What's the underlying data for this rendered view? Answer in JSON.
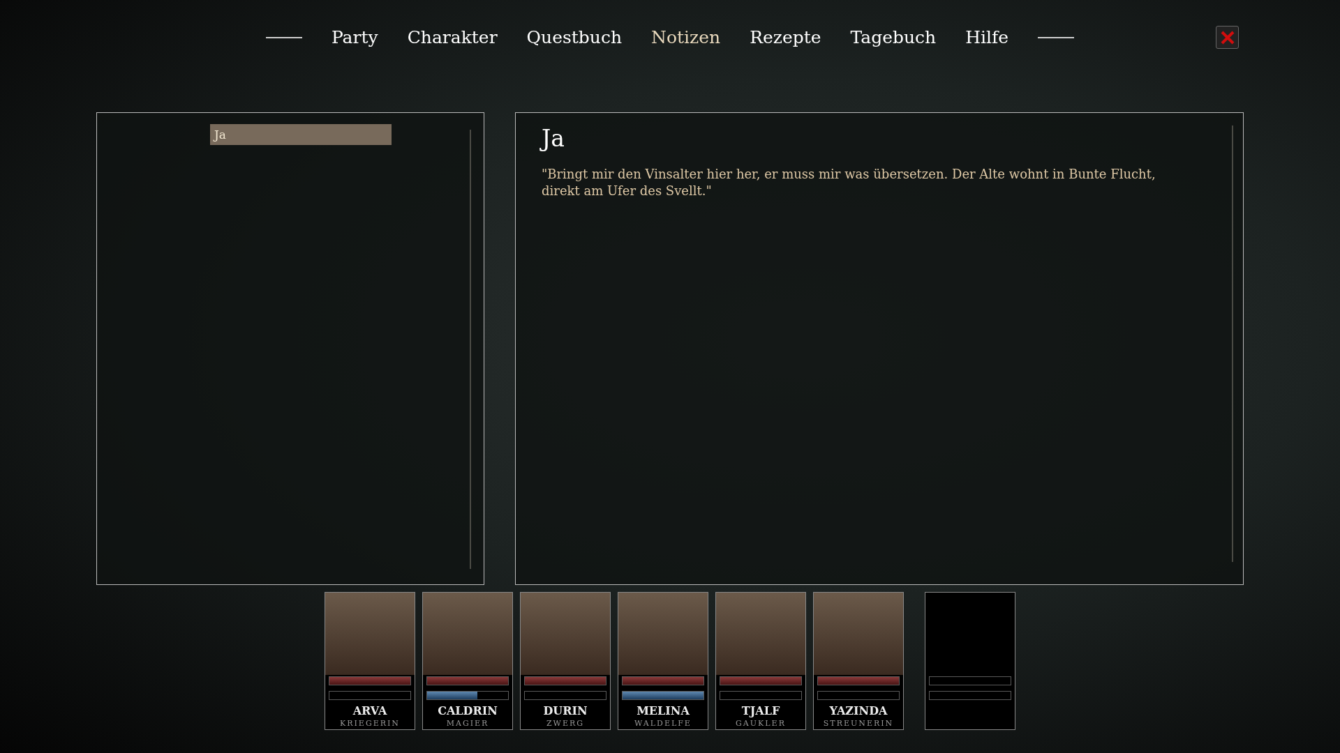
{
  "tabs": [
    {
      "label": "Party",
      "selected": false
    },
    {
      "label": "Charakter",
      "selected": false
    },
    {
      "label": "Questbuch",
      "selected": false
    },
    {
      "label": "Notizen",
      "selected": true
    },
    {
      "label": "Rezepte",
      "selected": false
    },
    {
      "label": "Tagebuch",
      "selected": false
    },
    {
      "label": "Hilfe",
      "selected": false
    }
  ],
  "notes_list": [
    {
      "title": "Ja",
      "selected": true
    }
  ],
  "note": {
    "title": "Ja",
    "body": "\"Bringt mir den Vinsalter hier her, er muss mir was übersetzen. Der Alte wohnt in Bunte Flucht, direkt am Ufer des Svellt.\""
  },
  "party": [
    {
      "kind": "hero",
      "name": "ARVA",
      "class": "KRIEGERIN",
      "health": {
        "level": 1
      },
      "mana": {
        "level": 0
      }
    },
    {
      "kind": "hero",
      "name": "CALDRIN",
      "class": "MAGIER",
      "health": {
        "level": 1
      },
      "mana": {
        "level": 0.62
      }
    },
    {
      "kind": "hero",
      "name": "DURIN",
      "class": "ZWERG",
      "health": {
        "level": 1
      },
      "mana": {
        "level": 0
      }
    },
    {
      "kind": "hero",
      "name": "MELINA",
      "class": "WALDELFE",
      "health": {
        "level": 1
      },
      "mana": {
        "level": 1
      }
    },
    {
      "kind": "hero",
      "name": "TJALF",
      "class": "GAUKLER",
      "health": {
        "level": 1
      },
      "mana": {
        "level": 0
      }
    },
    {
      "kind": "hero",
      "name": "YAZINDA",
      "class": "STREUNERIN",
      "health": {
        "level": 1
      },
      "mana": {
        "level": 0
      }
    },
    {
      "kind": "empty"
    }
  ]
}
